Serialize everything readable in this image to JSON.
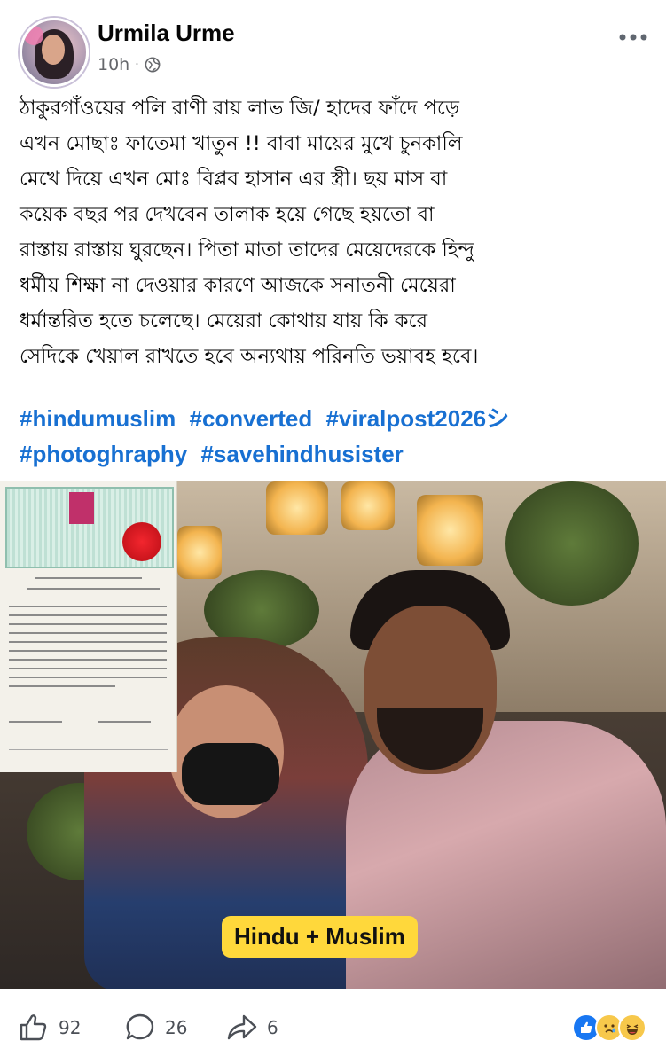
{
  "post": {
    "author_name": "Urmila Urme",
    "time": "10h",
    "separator": "·",
    "privacy_icon": "globe-icon",
    "more_icon": "more-icon",
    "text": "ঠাকুরগাঁওয়ের পলি রাণী রায় লাভ জি/ হাদের ফাঁদে পড়ে\nএখন মোছাঃ ফাতেমা খাতুন !! বাবা মায়ের মুখে চুনকালি\nমেখে দিয়ে এখন মোঃ বিপ্লব হাসান এর স্ত্রী। ছয় মাস বা\nকয়েক বছর পর দেখবেন তালাক হয়ে গেছে হয়তো বা\nরাস্তায় রাস্তায় ঘুরছেন। পিতা মাতা তাদের মেয়েদেরকে হিন্দু\nধর্মীয় শিক্ষা না দেওয়ার কারণে আজকে সনাতনী মেয়েরা\nধর্মান্তরিত হতে চলেছে। মেয়েরা কোথায় যায় কি করে\nসেদিকে খেয়াল রাখতে হবে অন্যথায় পরিনতি ভয়াবহ হবে।",
    "hashtags": [
      "#hindumuslim",
      "#converted",
      "#viralpost2026シ",
      "#photoghraphy",
      "#savehindhusister"
    ],
    "image_badge": "Hindu + Muslim"
  },
  "footer": {
    "likes": "92",
    "comments": "26",
    "shares": "6",
    "like_icon": "thumbs-up-icon",
    "comment_icon": "comment-bubble-icon",
    "share_icon": "share-arrow-icon",
    "reactions": [
      "like",
      "sad",
      "haha"
    ]
  },
  "colors": {
    "hashtag": "#1870d2",
    "meta": "#65676b",
    "badge": "#ffd83b"
  }
}
